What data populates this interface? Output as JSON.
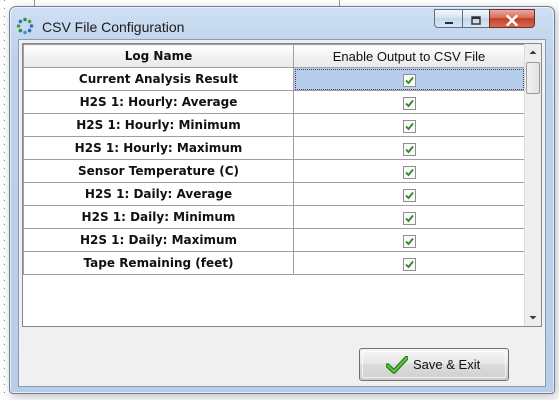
{
  "window": {
    "title": "CSV File Configuration",
    "controls": {
      "minimize": "minimize",
      "maximize": "maximize",
      "close": "close"
    }
  },
  "grid": {
    "headers": [
      "Log Name",
      "Enable Output to CSV File"
    ],
    "rows": [
      {
        "name": "Current Analysis Result",
        "enabled": true,
        "selected": true
      },
      {
        "name": "H2S 1: Hourly: Average",
        "enabled": true
      },
      {
        "name": "H2S 1: Hourly: Minimum",
        "enabled": true
      },
      {
        "name": "H2S 1: Hourly: Maximum",
        "enabled": true
      },
      {
        "name": "Sensor Temperature (C)",
        "enabled": true
      },
      {
        "name": "H2S 1: Daily: Average",
        "enabled": true
      },
      {
        "name": "H2S 1: Daily: Minimum",
        "enabled": true
      },
      {
        "name": "H2S 1: Daily: Maximum",
        "enabled": true
      },
      {
        "name": "Tape Remaining (feet)",
        "enabled": true
      }
    ]
  },
  "buttons": {
    "save_exit": "Save & Exit"
  },
  "icons": {
    "app": "gear-dots-icon",
    "save": "checkmark-icon"
  },
  "colors": {
    "selection": "#b7cdee",
    "check": "#2a8a1e",
    "close_button": "#c1402a"
  }
}
